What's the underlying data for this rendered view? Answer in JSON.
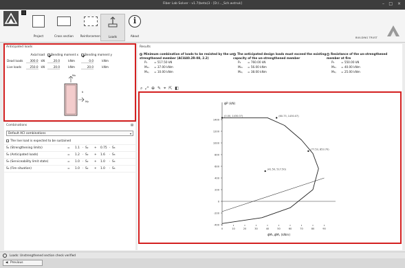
{
  "window": {
    "title": "Fiber Lab Solver - v1.7(beta)3 - [D:/..._Sch.wstruk]",
    "min": "–",
    "max": "□",
    "close": "×"
  },
  "ribbon": {
    "tabs": [
      {
        "label": "Project"
      },
      {
        "label": "Cross section"
      },
      {
        "label": "Reinforcement"
      },
      {
        "label": "Loads"
      },
      {
        "label": "About"
      }
    ],
    "about_glyph": "i",
    "right_label": "BUILDING TRUST"
  },
  "loads_panel": {
    "title": "Anticipated loads",
    "columns": [
      "Axial load",
      "Bending moment x",
      "Bending moment y"
    ],
    "rows": [
      {
        "label": "Dead loads",
        "values": [
          "300.0",
          "20.0",
          "0.0"
        ],
        "units": [
          "kN",
          "kNm",
          "kNm"
        ]
      },
      {
        "label": "Live loads",
        "values": [
          "250.0",
          "20.0",
          "20.0"
        ],
        "units": [
          "kN",
          "kNm",
          "kNm"
        ]
      }
    ],
    "diagram": {
      "label_top": "Mx",
      "label_right": "My",
      "label_side": "b"
    }
  },
  "combinations": {
    "title": "Combinations",
    "collapse_glyph": "▤",
    "select_value": "Default ACI combinations",
    "checkbox_label": "The live load is expected to be sustained",
    "rows": [
      {
        "name": "S₁ (Strengthening limits)",
        "f1": "1.1",
        "t1": "S₂",
        "f2": "0.75",
        "t2": "S₃"
      },
      {
        "name": "S₂ (Anticipated loads)",
        "f1": "1.2",
        "t1": "S₂",
        "f2": "1.6",
        "t2": "S₃"
      },
      {
        "name": "S₃ (Serviceability limit state)",
        "f1": "1.0",
        "t1": "S₂",
        "f2": "1.0",
        "t2": "S₃"
      },
      {
        "name": "S₄ (Fire situation)",
        "f1": "1.0",
        "t1": "S₂",
        "f2": "1.0",
        "t2": "S₃"
      }
    ]
  },
  "results": {
    "title": "Results",
    "options": [
      {
        "title": "Minimum combination of loads to be resisted by the un-strengthened member (ACI440.2R-08, 2.2)",
        "checked": true,
        "values": [
          [
            "P₁",
            "= 517.50 kN"
          ],
          [
            "M₁ₓ",
            "= 37.00 kNm"
          ],
          [
            "M₁ᵧ",
            "= 10.00 kNm"
          ]
        ]
      },
      {
        "title": "The anticipated design loads must exceed the existing capacity of the un-strengthened member",
        "checked": true,
        "values": [
          [
            "P₂",
            "= 760.00 kN"
          ],
          [
            "M₂ₓ",
            "= 56.00 kNm"
          ],
          [
            "M₂ᵧ",
            "= 38.00 kNm"
          ]
        ]
      },
      {
        "title": "Resistance of the un-strengthened member at fire",
        "checked": false,
        "values": [
          [
            "P₃",
            "= 550.00 kN"
          ],
          [
            "M₃ₓ",
            "= 40.00 kNm"
          ],
          [
            "M₃ᵧ",
            "= 25.00 kNm"
          ]
        ]
      }
    ],
    "toolbar_icons": [
      "⌕",
      "⤢",
      "⊕",
      "✎",
      "⌖",
      "⇱",
      "◧"
    ]
  },
  "chart_data": {
    "type": "line",
    "ylabel": "ϕP (kN)",
    "xlabel": "ϕMₓ,ϕMᵧ (kNm)",
    "xlim": [
      0,
      100
    ],
    "ylim": [
      -400,
      1600
    ],
    "xticks": [
      0,
      10,
      20,
      30,
      40,
      50,
      60,
      70,
      80,
      90
    ],
    "yticks": [
      -400,
      -200,
      0,
      200,
      400,
      600,
      800,
      1000,
      1200,
      1400
    ],
    "series": [
      {
        "values": [
          [
            0,
            1430
          ],
          [
            40,
            1430
          ],
          [
            55,
            1300
          ],
          [
            70,
            1050
          ],
          [
            80,
            820
          ],
          [
            85,
            560
          ],
          [
            80,
            200
          ],
          [
            60,
            -110
          ],
          [
            35,
            -280
          ],
          [
            0,
            -380
          ]
        ]
      }
    ],
    "aux_lines": [
      {
        "values": [
          [
            0,
            -175
          ],
          [
            90,
            400
          ]
        ]
      }
    ],
    "points": [
      {
        "label": "(0.00, 1430.07)",
        "x": 0,
        "y": 1430
      },
      {
        "label": "(60.73, 1430.07)",
        "x": 48,
        "y": 1430
      },
      {
        "label": "(77.53, 853.70)",
        "x": 76,
        "y": 860
      },
      {
        "label": "(41.50, 517.50)",
        "x": 38,
        "y": 517
      }
    ]
  },
  "status": {
    "text": "Loads: Unstrengthened section check verified"
  },
  "nav": {
    "prev_label": "Previous",
    "prev_glyph": "◀"
  }
}
